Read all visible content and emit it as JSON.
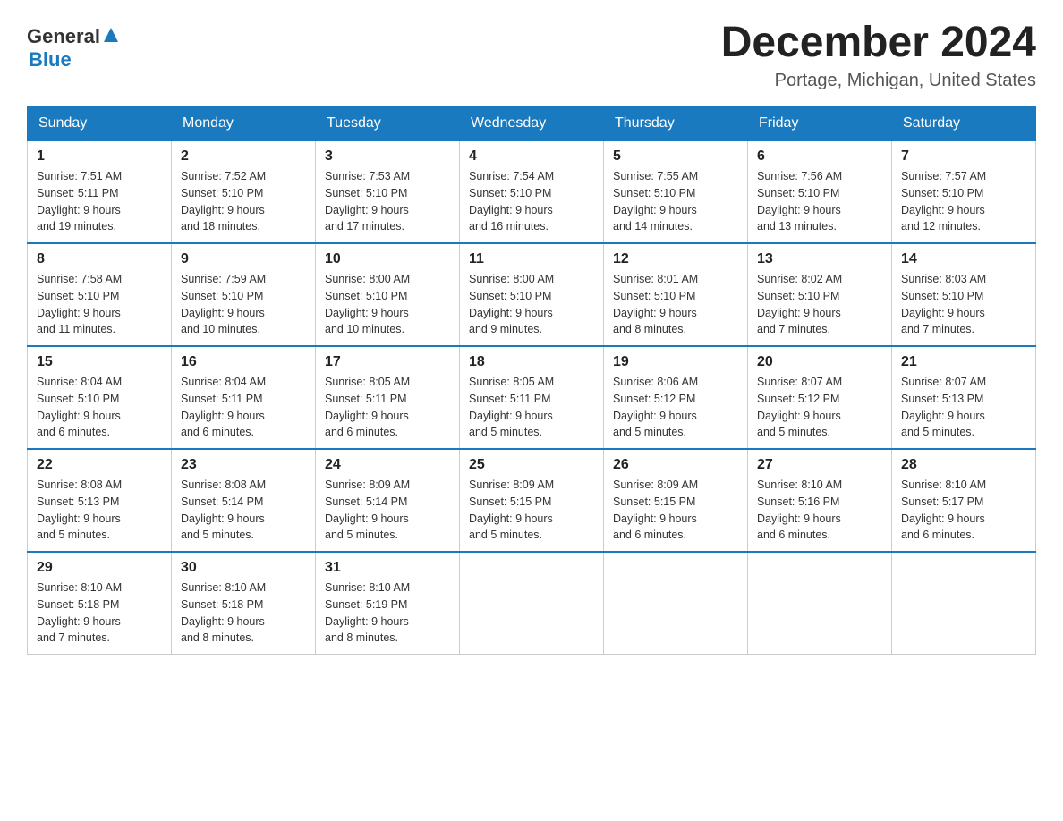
{
  "header": {
    "logo_part1": "General",
    "logo_part2": "Blue",
    "month_title": "December 2024",
    "location": "Portage, Michigan, United States"
  },
  "days_of_week": [
    "Sunday",
    "Monday",
    "Tuesday",
    "Wednesday",
    "Thursday",
    "Friday",
    "Saturday"
  ],
  "weeks": [
    [
      {
        "day": "1",
        "sunrise": "7:51 AM",
        "sunset": "5:11 PM",
        "daylight": "9 hours and 19 minutes."
      },
      {
        "day": "2",
        "sunrise": "7:52 AM",
        "sunset": "5:10 PM",
        "daylight": "9 hours and 18 minutes."
      },
      {
        "day": "3",
        "sunrise": "7:53 AM",
        "sunset": "5:10 PM",
        "daylight": "9 hours and 17 minutes."
      },
      {
        "day": "4",
        "sunrise": "7:54 AM",
        "sunset": "5:10 PM",
        "daylight": "9 hours and 16 minutes."
      },
      {
        "day": "5",
        "sunrise": "7:55 AM",
        "sunset": "5:10 PM",
        "daylight": "9 hours and 14 minutes."
      },
      {
        "day": "6",
        "sunrise": "7:56 AM",
        "sunset": "5:10 PM",
        "daylight": "9 hours and 13 minutes."
      },
      {
        "day": "7",
        "sunrise": "7:57 AM",
        "sunset": "5:10 PM",
        "daylight": "9 hours and 12 minutes."
      }
    ],
    [
      {
        "day": "8",
        "sunrise": "7:58 AM",
        "sunset": "5:10 PM",
        "daylight": "9 hours and 11 minutes."
      },
      {
        "day": "9",
        "sunrise": "7:59 AM",
        "sunset": "5:10 PM",
        "daylight": "9 hours and 10 minutes."
      },
      {
        "day": "10",
        "sunrise": "8:00 AM",
        "sunset": "5:10 PM",
        "daylight": "9 hours and 10 minutes."
      },
      {
        "day": "11",
        "sunrise": "8:00 AM",
        "sunset": "5:10 PM",
        "daylight": "9 hours and 9 minutes."
      },
      {
        "day": "12",
        "sunrise": "8:01 AM",
        "sunset": "5:10 PM",
        "daylight": "9 hours and 8 minutes."
      },
      {
        "day": "13",
        "sunrise": "8:02 AM",
        "sunset": "5:10 PM",
        "daylight": "9 hours and 7 minutes."
      },
      {
        "day": "14",
        "sunrise": "8:03 AM",
        "sunset": "5:10 PM",
        "daylight": "9 hours and 7 minutes."
      }
    ],
    [
      {
        "day": "15",
        "sunrise": "8:04 AM",
        "sunset": "5:10 PM",
        "daylight": "9 hours and 6 minutes."
      },
      {
        "day": "16",
        "sunrise": "8:04 AM",
        "sunset": "5:11 PM",
        "daylight": "9 hours and 6 minutes."
      },
      {
        "day": "17",
        "sunrise": "8:05 AM",
        "sunset": "5:11 PM",
        "daylight": "9 hours and 6 minutes."
      },
      {
        "day": "18",
        "sunrise": "8:05 AM",
        "sunset": "5:11 PM",
        "daylight": "9 hours and 5 minutes."
      },
      {
        "day": "19",
        "sunrise": "8:06 AM",
        "sunset": "5:12 PM",
        "daylight": "9 hours and 5 minutes."
      },
      {
        "day": "20",
        "sunrise": "8:07 AM",
        "sunset": "5:12 PM",
        "daylight": "9 hours and 5 minutes."
      },
      {
        "day": "21",
        "sunrise": "8:07 AM",
        "sunset": "5:13 PM",
        "daylight": "9 hours and 5 minutes."
      }
    ],
    [
      {
        "day": "22",
        "sunrise": "8:08 AM",
        "sunset": "5:13 PM",
        "daylight": "9 hours and 5 minutes."
      },
      {
        "day": "23",
        "sunrise": "8:08 AM",
        "sunset": "5:14 PM",
        "daylight": "9 hours and 5 minutes."
      },
      {
        "day": "24",
        "sunrise": "8:09 AM",
        "sunset": "5:14 PM",
        "daylight": "9 hours and 5 minutes."
      },
      {
        "day": "25",
        "sunrise": "8:09 AM",
        "sunset": "5:15 PM",
        "daylight": "9 hours and 5 minutes."
      },
      {
        "day": "26",
        "sunrise": "8:09 AM",
        "sunset": "5:15 PM",
        "daylight": "9 hours and 6 minutes."
      },
      {
        "day": "27",
        "sunrise": "8:10 AM",
        "sunset": "5:16 PM",
        "daylight": "9 hours and 6 minutes."
      },
      {
        "day": "28",
        "sunrise": "8:10 AM",
        "sunset": "5:17 PM",
        "daylight": "9 hours and 6 minutes."
      }
    ],
    [
      {
        "day": "29",
        "sunrise": "8:10 AM",
        "sunset": "5:18 PM",
        "daylight": "9 hours and 7 minutes."
      },
      {
        "day": "30",
        "sunrise": "8:10 AM",
        "sunset": "5:18 PM",
        "daylight": "9 hours and 8 minutes."
      },
      {
        "day": "31",
        "sunrise": "8:10 AM",
        "sunset": "5:19 PM",
        "daylight": "9 hours and 8 minutes."
      },
      null,
      null,
      null,
      null
    ]
  ]
}
